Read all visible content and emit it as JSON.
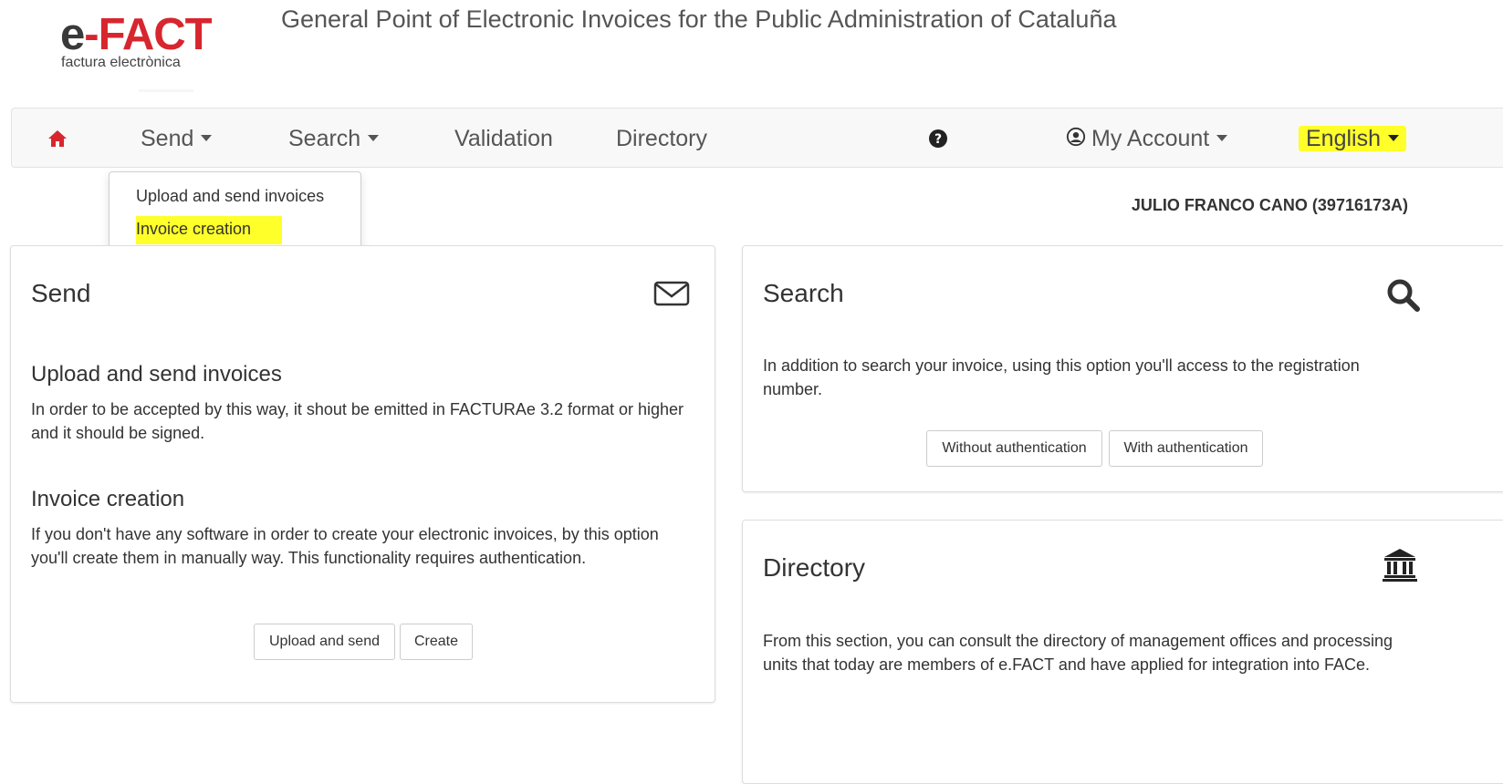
{
  "logo": {
    "part1": "e",
    "part2": "-",
    "part3": "FACT",
    "subtitle": "factura electrònica"
  },
  "page_title": "General Point of Electronic Invoices for the Public Administration of Cataluña",
  "navbar": {
    "send": "Send",
    "search": "Search",
    "validation": "Validation",
    "directory": "Directory",
    "my_account": "My Account",
    "language": "English"
  },
  "send_dropdown": {
    "items": [
      "Upload and send invoices",
      "Invoice creation"
    ]
  },
  "user": "JULIO FRANCO CANO (39716173A)",
  "send_panel": {
    "title": "Send",
    "upload_title": "Upload and send invoices",
    "upload_text": "In order to be accepted by this way, it shout be emitted in FACTURAe 3.2 format or higher and it should be signed.",
    "creation_title": "Invoice creation",
    "creation_text": "If you don't have any software in order to create your electronic invoices, by this option you'll create them in manually way. This functionality requires authentication.",
    "btn_upload": "Upload and send",
    "btn_create": "Create"
  },
  "search_panel": {
    "title": "Search",
    "text": "In addition to search your invoice, using this option you'll access to the registration number.",
    "btn_without": "Without authentication",
    "btn_with": "With authentication"
  },
  "directory_panel": {
    "title": "Directory",
    "text": "From this section, you can consult the directory of management offices and processing units that today are members of e.FACT and have applied for integration into FACe."
  },
  "colors": {
    "brand_red": "#d7262e",
    "highlight": "#ffff2a",
    "navbar_bg": "#f8f8f8"
  }
}
